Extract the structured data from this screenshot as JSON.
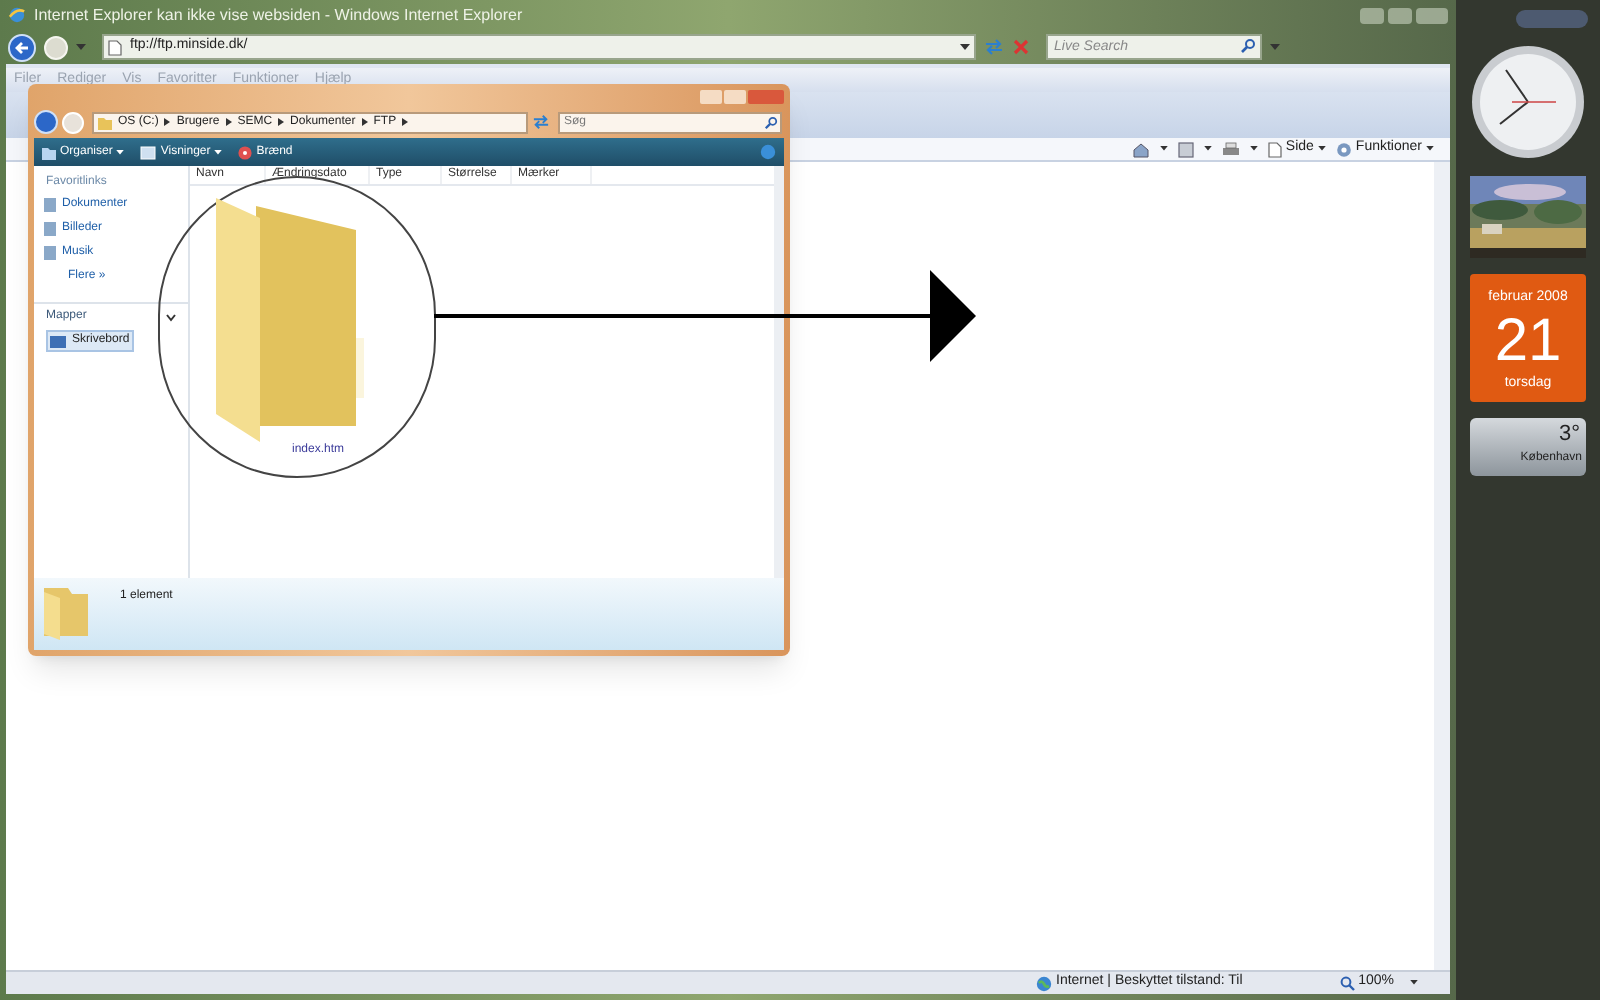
{
  "ie": {
    "title": "Internet Explorer kan ikke vise websiden - Windows Internet Explorer",
    "address": "ftp://ftp.minside.dk/",
    "search_placeholder": "Live Search",
    "menu": [
      "Filer",
      "Rediger",
      "Vis",
      "Favoritter",
      "Funktioner",
      "Hjælp"
    ],
    "commands": [
      "Side",
      "Funktioner"
    ],
    "status": "Internet | Beskyttet tilstand: Til",
    "zoom": "100%"
  },
  "explorer": {
    "breadcrumb": [
      "OS (C:)",
      "Brugere",
      "SEMC",
      "Dokumenter",
      "FTP"
    ],
    "search_placeholder": "Søg",
    "toolbar": [
      "Organiser",
      "Visninger",
      "Brænd"
    ],
    "favorites_heading": "Favoritlinks",
    "favorites": [
      "Dokumenter",
      "Billeder",
      "Musik"
    ],
    "more": "Flere »",
    "folders_heading": "Mapper",
    "folders": [
      {
        "label": "Skrivebord",
        "selected": true
      }
    ],
    "columns": [
      "Navn",
      "Ændringsdato",
      "Type",
      "Størrelse",
      "Mærker"
    ],
    "files": [
      {
        "name": "index.htm"
      }
    ],
    "status": "1 element"
  },
  "gadgets": {
    "calendar": {
      "month": "februar 2008",
      "day": "21",
      "weekday": "torsdag"
    },
    "weather": {
      "temp": "3°",
      "city": "København"
    }
  }
}
